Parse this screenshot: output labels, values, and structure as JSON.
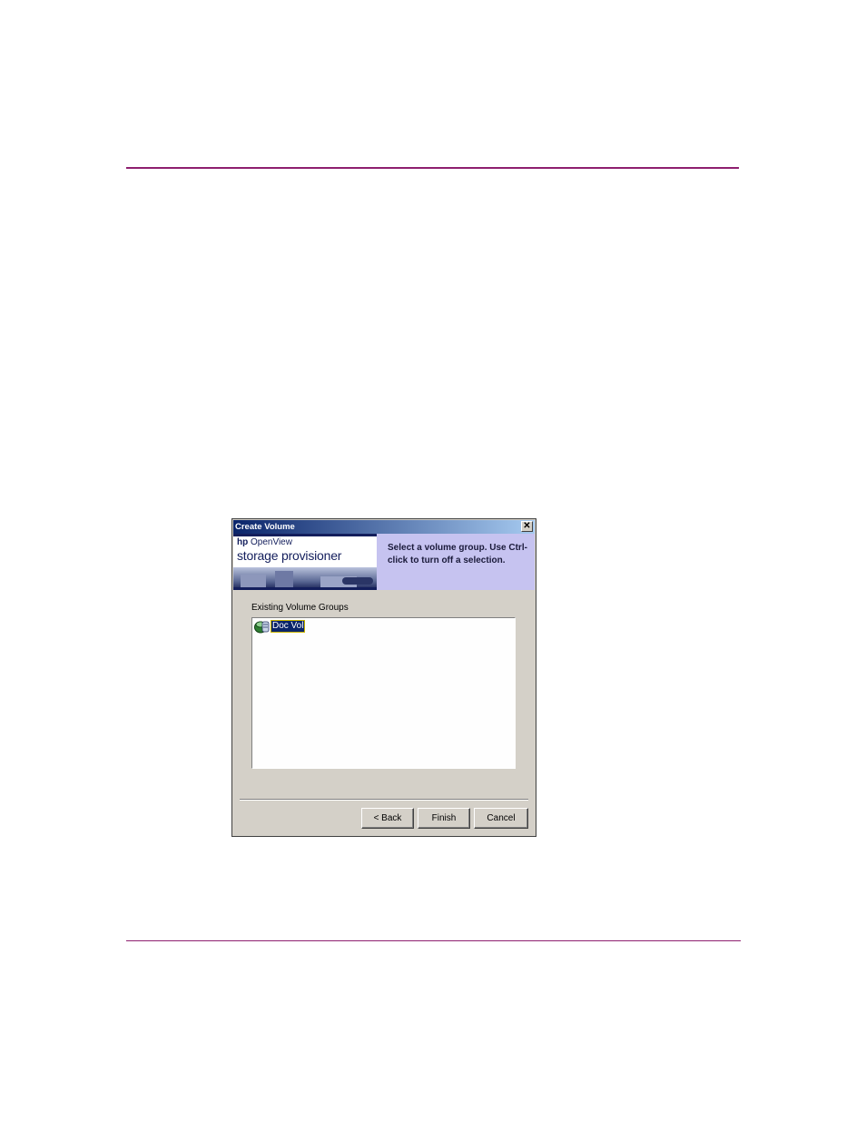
{
  "dialog": {
    "title": "Create Volume",
    "close_glyph": "✕",
    "banner": {
      "logo_brand": "hp",
      "logo_product": "OpenView",
      "logo_name": "storage provisioner",
      "instruction": "Select a volume group.  Use Ctrl-click to turn off a selection."
    },
    "list_label": "Existing Volume Groups",
    "volume_groups": [
      {
        "label": "Doc Vol",
        "icon": "volume-group-icon",
        "selected": true
      }
    ],
    "buttons": {
      "back": "< Back",
      "finish": "Finish",
      "cancel": "Cancel"
    }
  },
  "colors": {
    "rule": "#8e1f6f",
    "title_gradient_start": "#0a246a",
    "banner_bg": "#c6c3f0",
    "selection": "#0a246a",
    "dialog_face": "#d4d0c8"
  }
}
